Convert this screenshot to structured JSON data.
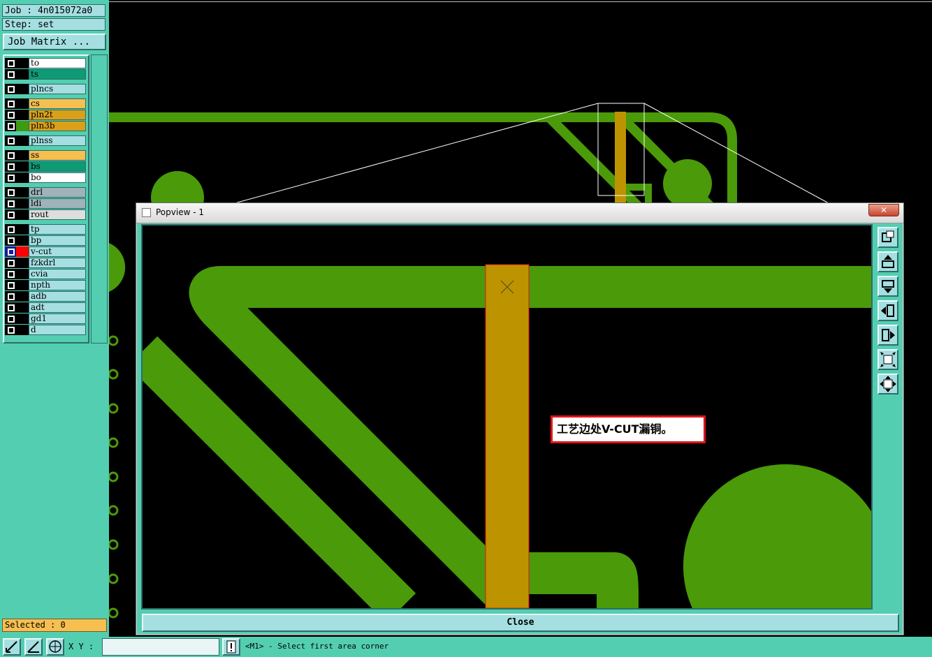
{
  "job": {
    "label": "Job : 4n015072a0"
  },
  "step": {
    "label": "Step: set"
  },
  "job_matrix_button": "Job Matrix ...",
  "layers": [
    {
      "name": "to",
      "color": "#ffffff",
      "swatch": "#000000",
      "selected": false
    },
    {
      "name": "ts",
      "color": "#0f9a76",
      "swatch": "#000000",
      "selected": false
    },
    {
      "name": "plncs",
      "color": "#a5dfe2",
      "swatch": "#000000",
      "selected": false
    },
    {
      "name": "cs",
      "color": "#f6bf4f",
      "swatch": "#000000",
      "selected": false
    },
    {
      "name": "pln2t",
      "color": "#d9a018",
      "swatch": "#000000",
      "selected": false
    },
    {
      "name": "pln3b",
      "color": "#d9a018",
      "swatch": "#3e9a14",
      "selected": false
    },
    {
      "name": "plnss",
      "color": "#a5dfe2",
      "swatch": "#000000",
      "selected": false
    },
    {
      "name": "ss",
      "color": "#f6bf4f",
      "swatch": "#000000",
      "selected": false
    },
    {
      "name": "bs",
      "color": "#0f9a76",
      "swatch": "#000000",
      "selected": false
    },
    {
      "name": "bo",
      "color": "#ffffff",
      "swatch": "#000000",
      "selected": false
    },
    {
      "name": "drl",
      "color": "#9fb3ba",
      "swatch": "#000000",
      "selected": false
    },
    {
      "name": "ldi",
      "color": "#9fb3ba",
      "swatch": "#000000",
      "selected": false
    },
    {
      "name": "rout",
      "color": "#dedede",
      "swatch": "#000000",
      "selected": false
    },
    {
      "name": "tp",
      "color": "#a5dfe2",
      "swatch": "#000000",
      "selected": false
    },
    {
      "name": "bp",
      "color": "#a5dfe2",
      "swatch": "#000000",
      "selected": false
    },
    {
      "name": "v-cut",
      "color": "#a5dfe2",
      "swatch": "#ff0000",
      "selected": true
    },
    {
      "name": "fzkdrl",
      "color": "#a5dfe2",
      "swatch": "#000000",
      "selected": false
    },
    {
      "name": "cvia",
      "color": "#a5dfe2",
      "swatch": "#000000",
      "selected": false
    },
    {
      "name": "npth",
      "color": "#a5dfe2",
      "swatch": "#000000",
      "selected": false
    },
    {
      "name": "adb",
      "color": "#a5dfe2",
      "swatch": "#000000",
      "selected": false
    },
    {
      "name": "adt",
      "color": "#a5dfe2",
      "swatch": "#000000",
      "selected": false
    },
    {
      "name": "gd1",
      "color": "#a5dfe2",
      "swatch": "#000000",
      "selected": false
    },
    {
      "name": "d",
      "color": "#a5dfe2",
      "swatch": "#000000",
      "selected": false
    }
  ],
  "selected_status": "Selected : 0",
  "status_bar": {
    "xy_label": "X Y :",
    "xy_value": "",
    "prompt": "<M1> - Select first area corner"
  },
  "popview": {
    "title": "Popview - 1",
    "close_x": "✕",
    "close_button": "Close",
    "annotation": "工艺边处V-CUT漏铜。",
    "toolbar_icons": [
      "zoom-window-icon",
      "pan-up-icon",
      "pan-down-icon",
      "pan-left-icon",
      "pan-right-icon",
      "zoom-out-icon",
      "zoom-home-icon"
    ]
  },
  "colors": {
    "panel": "#54ceb0",
    "button": "#a5dfe2",
    "trace": "#4a9a0a",
    "vcut": "#bd9400"
  }
}
